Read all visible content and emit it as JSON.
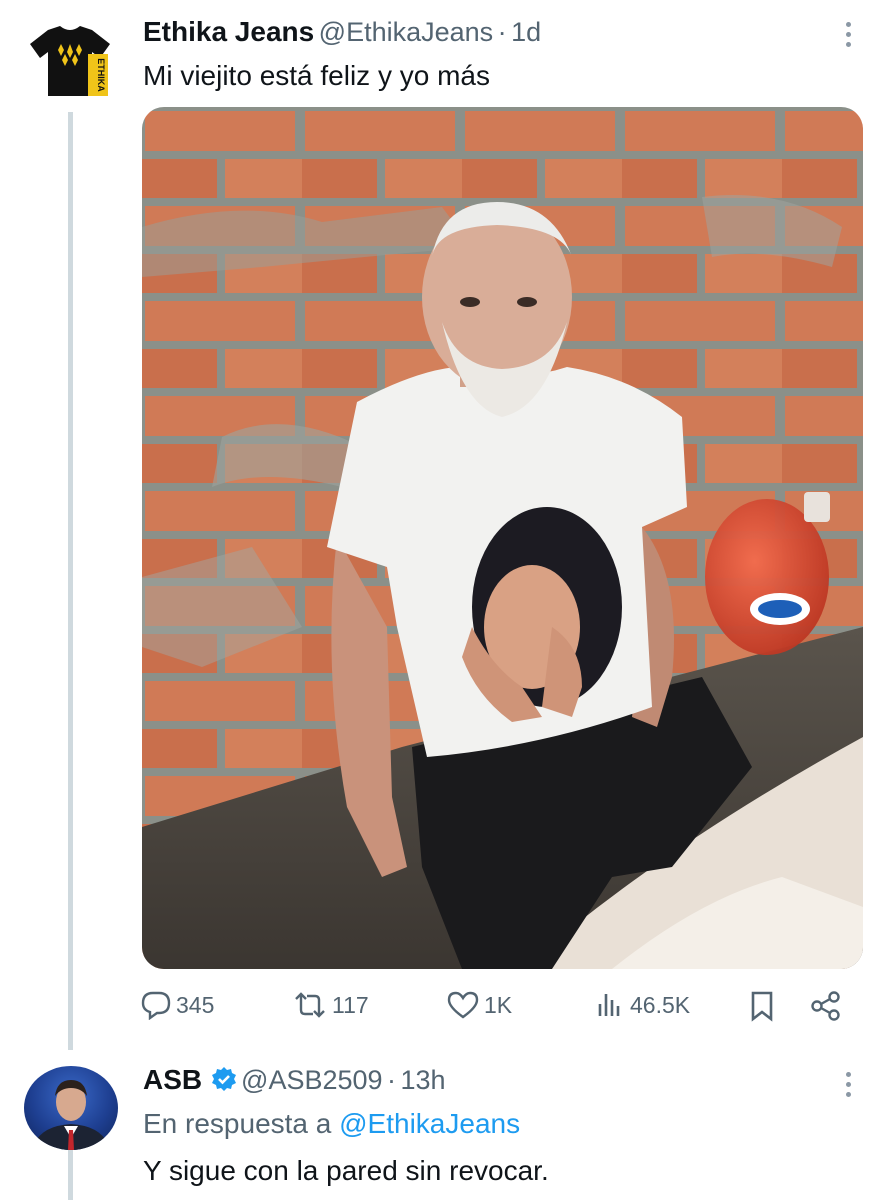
{
  "tweet": {
    "author_name": "Ethika Jeans",
    "author_handle": "@EthikaJeans",
    "dot": "·",
    "time": "1d",
    "text": "Mi viejito está feliz y yo más",
    "avatar_icon": "tshirt-logo-icon",
    "avatar_brand": "ETHIKA",
    "media_alt": "photo-elderly-man-tshirt",
    "actions": {
      "replies": "345",
      "retweets": "117",
      "likes": "1K",
      "views": "46.5K"
    },
    "action_icons": [
      "reply-icon",
      "retweet-icon",
      "like-icon",
      "views-icon",
      "bookmark-icon",
      "share-icon"
    ]
  },
  "reply": {
    "author_name": "ASB",
    "author_handle": "@ASB2509",
    "dot": "·",
    "time": "13h",
    "verified_icon": "verified-badge-icon",
    "in_reply_to_prefix": "En respuesta a",
    "in_reply_to_handle": "@EthikaJeans",
    "text": "Y sigue con la pared sin revocar."
  },
  "colors": {
    "text": "#0f1419",
    "muted": "#536471",
    "link": "#1d9bf0",
    "thread_line": "#cfd9de"
  }
}
